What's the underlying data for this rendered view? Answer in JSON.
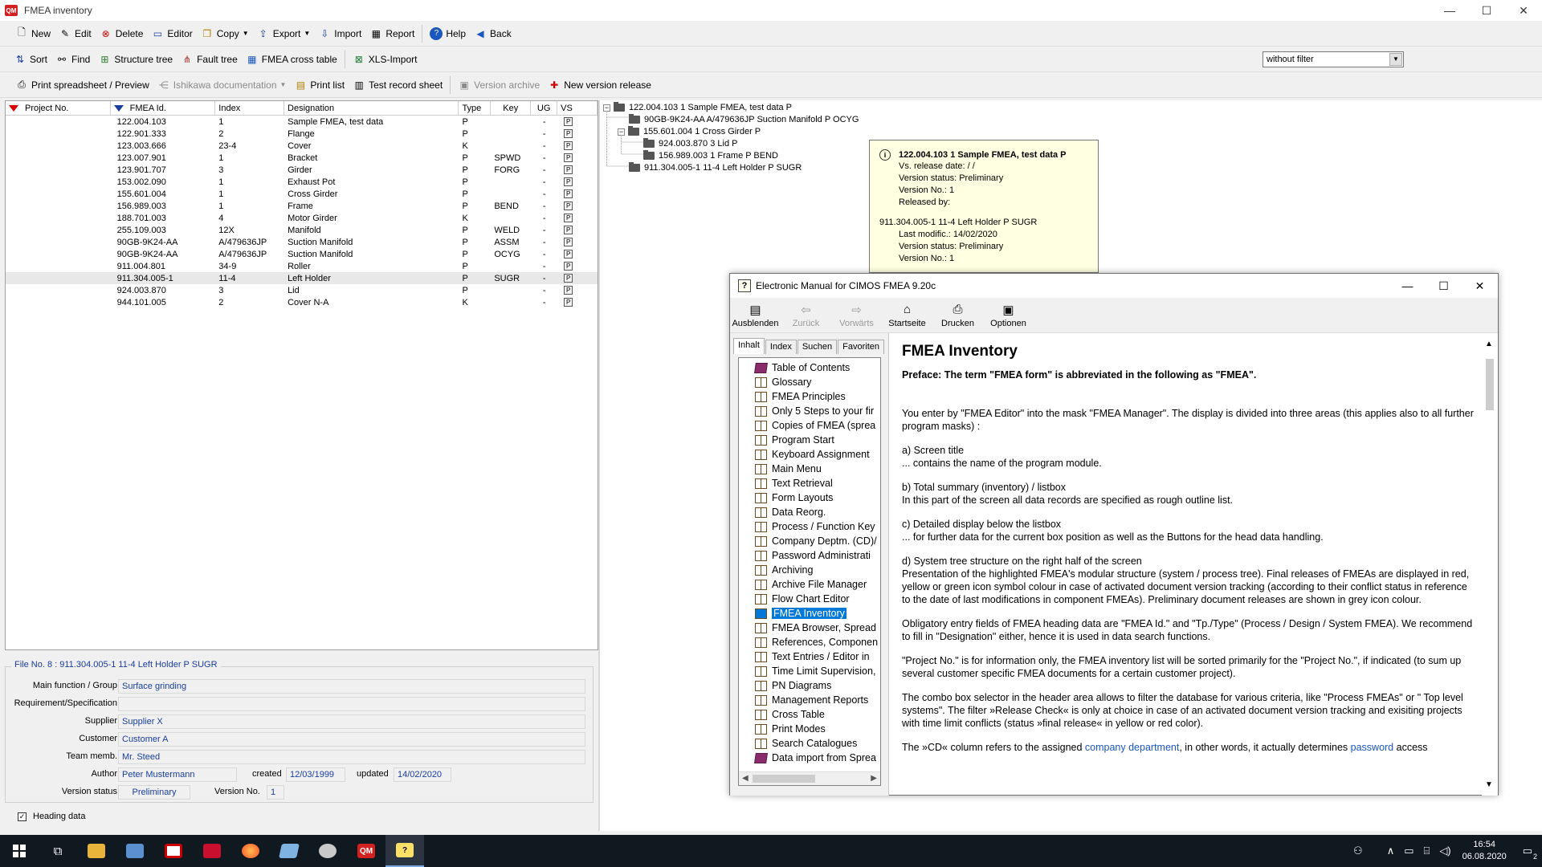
{
  "window": {
    "title": "FMEA inventory",
    "app_badge": "QM",
    "controls": [
      "—",
      "☐",
      "✕"
    ]
  },
  "toolbar1": [
    {
      "label": "New",
      "icon": "new-document-icon"
    },
    {
      "label": "Edit",
      "icon": "edit-icon"
    },
    {
      "label": "Delete",
      "icon": "delete-icon"
    },
    {
      "label": "Editor",
      "icon": "editor-icon"
    },
    {
      "label": "Copy",
      "icon": "copy-icon",
      "dropdown": true
    },
    {
      "label": "Export",
      "icon": "export-icon",
      "dropdown": true
    },
    {
      "label": "Import",
      "icon": "import-icon"
    },
    {
      "label": "Report",
      "icon": "report-icon"
    },
    {
      "label": "Help",
      "icon": "help-icon"
    },
    {
      "label": "Back",
      "icon": "back-arrow-icon"
    }
  ],
  "toolbar2": [
    {
      "label": "Sort",
      "icon": "sort-icon"
    },
    {
      "label": "Find",
      "icon": "binoculars-icon"
    },
    {
      "label": "Structure tree",
      "icon": "structure-tree-icon"
    },
    {
      "label": "Fault tree",
      "icon": "fault-tree-icon"
    },
    {
      "label": "FMEA cross table",
      "icon": "cross-table-icon"
    },
    {
      "label": "XLS-Import",
      "icon": "xls-import-icon"
    }
  ],
  "filter": {
    "value": "without filter"
  },
  "toolbar3": [
    {
      "label": "Print spreadsheet / Preview",
      "icon": "printer-icon"
    },
    {
      "label": "Ishikawa documentation",
      "icon": "ishikawa-icon",
      "disabled": true,
      "dropdown": true
    },
    {
      "label": "Print list",
      "icon": "print-list-icon"
    },
    {
      "label": "Test record sheet",
      "icon": "test-record-icon"
    },
    {
      "label": "Version archive",
      "icon": "version-archive-icon",
      "disabled": true
    },
    {
      "label": "New version release",
      "icon": "new-version-icon"
    }
  ],
  "list": {
    "columns": {
      "project": "Project No.",
      "fmea_id": "FMEA Id.",
      "index": "Index",
      "designation": "Designation",
      "type": "Type",
      "key": "Key",
      "ug": "UG",
      "vs": "VS"
    },
    "rows": [
      {
        "fmea_id": "122.004.103",
        "index": "1",
        "designation": "Sample FMEA, test data",
        "type": "P",
        "key": "",
        "ug": "-",
        "vs": "P"
      },
      {
        "fmea_id": "122.901.333",
        "index": "2",
        "designation": "Flange",
        "type": "P",
        "key": "",
        "ug": "-",
        "vs": "P"
      },
      {
        "fmea_id": "123.003.666",
        "index": "23-4",
        "designation": "Cover",
        "type": "K",
        "key": "",
        "ug": "-",
        "vs": "P"
      },
      {
        "fmea_id": "123.007.901",
        "index": "1",
        "designation": "Bracket",
        "type": "P",
        "key": "SPWD",
        "ug": "-",
        "vs": "P"
      },
      {
        "fmea_id": "123.901.707",
        "index": "3",
        "designation": "Girder",
        "type": "P",
        "key": "FORG",
        "ug": "-",
        "vs": "P"
      },
      {
        "fmea_id": "153.002.090",
        "index": "1",
        "designation": "Exhaust Pot",
        "type": "P",
        "key": "",
        "ug": "-",
        "vs": "P"
      },
      {
        "fmea_id": "155.601.004",
        "index": "1",
        "designation": "Cross Girder",
        "type": "P",
        "key": "",
        "ug": "-",
        "vs": "P"
      },
      {
        "fmea_id": "156.989.003",
        "index": "1",
        "designation": "Frame",
        "type": "P",
        "key": "BEND",
        "ug": "-",
        "vs": "P"
      },
      {
        "fmea_id": "188.701.003",
        "index": "4",
        "designation": "Motor Girder",
        "type": "K",
        "key": "",
        "ug": "-",
        "vs": "P"
      },
      {
        "fmea_id": "255.109.003",
        "index": "12X",
        "designation": "Manifold",
        "type": "P",
        "key": "WELD",
        "ug": "-",
        "vs": "P"
      },
      {
        "fmea_id": "90GB-9K24-AA",
        "index": "A/479636JP",
        "designation": "Suction Manifold",
        "type": "P",
        "key": "ASSM",
        "ug": "-",
        "vs": "P"
      },
      {
        "fmea_id": "90GB-9K24-AA",
        "index": "A/479636JP",
        "designation": "Suction Manifold",
        "type": "P",
        "key": "OCYG",
        "ug": "-",
        "vs": "P"
      },
      {
        "fmea_id": "911.004.801",
        "index": "34-9",
        "designation": "Roller",
        "type": "P",
        "key": "",
        "ug": "-",
        "vs": "P"
      },
      {
        "fmea_id": "911.304.005-1",
        "index": "11-4",
        "designation": "Left Holder",
        "type": "P",
        "key": "SUGR",
        "ug": "-",
        "vs": "P",
        "selected": true
      },
      {
        "fmea_id": "924.003.870",
        "index": "3",
        "designation": "Lid",
        "type": "P",
        "key": "",
        "ug": "-",
        "vs": "P"
      },
      {
        "fmea_id": "944.101.005",
        "index": "2",
        "designation": "Cover N-A",
        "type": "K",
        "key": "",
        "ug": "-",
        "vs": "P"
      }
    ]
  },
  "tree": [
    {
      "label": "122.004.103  1  Sample FMEA, test data  P",
      "level": 0,
      "expander": "−"
    },
    {
      "label": "90GB-9K24-AA  A/479636JP  Suction Manifold  P  OCYG",
      "level": 1,
      "expander": ""
    },
    {
      "label": "155.601.004  1  Cross Girder  P",
      "level": 1,
      "expander": "−"
    },
    {
      "label": "924.003.870  3  Lid  P",
      "level": 2,
      "expander": ""
    },
    {
      "label": "156.989.003  1  Frame  P  BEND",
      "level": 2,
      "expander": ""
    },
    {
      "label": "911.304.005-1  11-4  Left Holder  P  SUGR",
      "level": 1,
      "expander": ""
    }
  ],
  "tooltip": {
    "head": "122.004.103  1  Sample FMEA, test data  P",
    "lines1": [
      "Vs. release date:  /  /",
      "Version status: Preliminary",
      "Version No.: 1",
      "Released by:"
    ],
    "sub": "911.304.005-1  11-4  Left Holder  P  SUGR",
    "lines2": [
      "Last modific.: 14/02/2020",
      "Version status: Preliminary",
      "Version No.: 1"
    ]
  },
  "head_data": {
    "file_label": "File No.  8 :   911.304.005-1  11-4  Left Holder  P  SUGR",
    "main_function_label": "Main function / Group",
    "main_function": "Surface grinding",
    "requirement_label": "Requirement/Specification",
    "requirement": "",
    "supplier_label": "Supplier",
    "supplier": "Supplier X",
    "customer_label": "Customer",
    "customer": "Customer A",
    "team_label": "Team memb.",
    "team": "Mr. Steed",
    "author_label": "Author",
    "author": "Peter Mustermann",
    "created_label": "created",
    "created": "12/03/1999",
    "updated_label": "updated",
    "updated": "14/02/2020",
    "version_status_label": "Version status",
    "version_status": "Preliminary",
    "version_no_label": "Version No.",
    "version_no": "1",
    "heading_checkbox": "Heading data"
  },
  "help": {
    "title": "Electronic Manual for CIMOS FMEA 9.20c",
    "tools": [
      {
        "label": "Ausblenden",
        "icon": "hide-pane-icon",
        "glyph": "▤"
      },
      {
        "label": "Zurück",
        "icon": "back-icon",
        "glyph": "⇦",
        "disabled": true
      },
      {
        "label": "Vorwärts",
        "icon": "forward-icon",
        "glyph": "⇨",
        "disabled": true
      },
      {
        "label": "Startseite",
        "icon": "home-icon",
        "glyph": "⌂"
      },
      {
        "label": "Drucken",
        "icon": "print-icon",
        "glyph": "⎙"
      },
      {
        "label": "Optionen",
        "icon": "options-icon",
        "glyph": "▣"
      }
    ],
    "tabs": [
      "Inhalt",
      "Index",
      "Suchen",
      "Favoriten"
    ],
    "toc": [
      {
        "label": "Table of Contents",
        "closed": true
      },
      {
        "label": "Glossary"
      },
      {
        "label": "FMEA Principles"
      },
      {
        "label": "Only 5 Steps to your fir"
      },
      {
        "label": "Copies of FMEA (sprea"
      },
      {
        "label": "Program Start"
      },
      {
        "label": "Keyboard Assignment"
      },
      {
        "label": "Main Menu"
      },
      {
        "label": "Text Retrieval"
      },
      {
        "label": "Form Layouts"
      },
      {
        "label": "Data Reorg."
      },
      {
        "label": "Process / Function Key"
      },
      {
        "label": "Company Deptm. (CD)/"
      },
      {
        "label": "Password Administrati"
      },
      {
        "label": "Archiving"
      },
      {
        "label": "Archive File Manager"
      },
      {
        "label": "Flow Chart Editor"
      },
      {
        "label": "FMEA Inventory",
        "selected": true
      },
      {
        "label": "FMEA Browser, Spread"
      },
      {
        "label": "References, Componen"
      },
      {
        "label": "Text Entries / Editor in"
      },
      {
        "label": "Time Limit Supervision,"
      },
      {
        "label": "PN  Diagrams"
      },
      {
        "label": "Management Reports"
      },
      {
        "label": "Cross Table"
      },
      {
        "label": "Print Modes"
      },
      {
        "label": "Search Catalogues"
      },
      {
        "label": "Data import from Sprea",
        "closed": true
      }
    ],
    "content": {
      "heading": "FMEA Inventory",
      "lead": "Preface: The term \"FMEA form\" is abbreviated in the following as \"FMEA\".",
      "p1": "You enter by \"FMEA Editor\" into the mask \"FMEA Manager\". The display is divided into three areas (this applies also to all further program masks) :",
      "a_title": "a)  Screen title",
      "a_text": "... contains the name of the program module.",
      "b_title": "b) Total summary (inventory) / listbox",
      "b_text": "In this part of the screen all data records are specified as rough outline list.",
      "c_title": "c) Detailed display below the listbox",
      "c_text": "... for further data for the current box position as well as the Buttons for the head data handling.",
      "d_title": "d) System tree structure on the right half of the screen",
      "d_text": "Presentation of the highlighted FMEA's modular structure (system / process tree). Final releases of FMEAs are displayed in red, yellow or green icon symbol colour in case of activated document version tracking (according to their conflict status in reference to the date of last modifications in component FMEAs). Preliminary document releases are shown in grey icon colour.",
      "p_oblig": "Obligatory entry fields of FMEA heading data are \"FMEA Id.\" and \"Tp./Type\" (Process / Design / System FMEA). We recommend to fill in \"Designation\" either, hence it is used in data search functions.",
      "p_proj": "\"Project No.\" is for information only, the FMEA inventory list will be sorted primarily for the \"Project No.\", if indicated (to sum up several customer specific FMEA documents for a certain customer project).",
      "p_combo": "The combo box selector in the header area allows to filter the database for various criteria, like \"Process FMEAs\" or \" Top level systems\". The filter »Release Check« is only at choice in case of an activated document version tracking and exisiting projects with time limit conflicts (status »final release« in yellow or red color).",
      "p_cd_pre": "The »CD« column refers to the assigned ",
      "p_cd_link1": "company department",
      "p_cd_mid": ", in other words, it actually determines ",
      "p_cd_link2": "password",
      "p_cd_post": " access"
    }
  },
  "taskbar": {
    "items": [
      "start-icon",
      "task-view-icon",
      "file-explorer-icon",
      "screen-app-icon",
      "antivirus-icon",
      "pdf-reader-icon",
      "firefox-icon",
      "notes-app-icon",
      "paint-app-icon",
      "qm-app-icon",
      "help-app-icon"
    ],
    "qm_badge": "QM",
    "time": "16:54",
    "date": "06.08.2020",
    "notifications": "2"
  },
  "colors": {
    "accent": "#0078d7",
    "link": "#1a57c0",
    "tooltip_bg": "#ffffe1",
    "field_text": "#1a3d9e",
    "sort_marker": "#dd0000"
  }
}
